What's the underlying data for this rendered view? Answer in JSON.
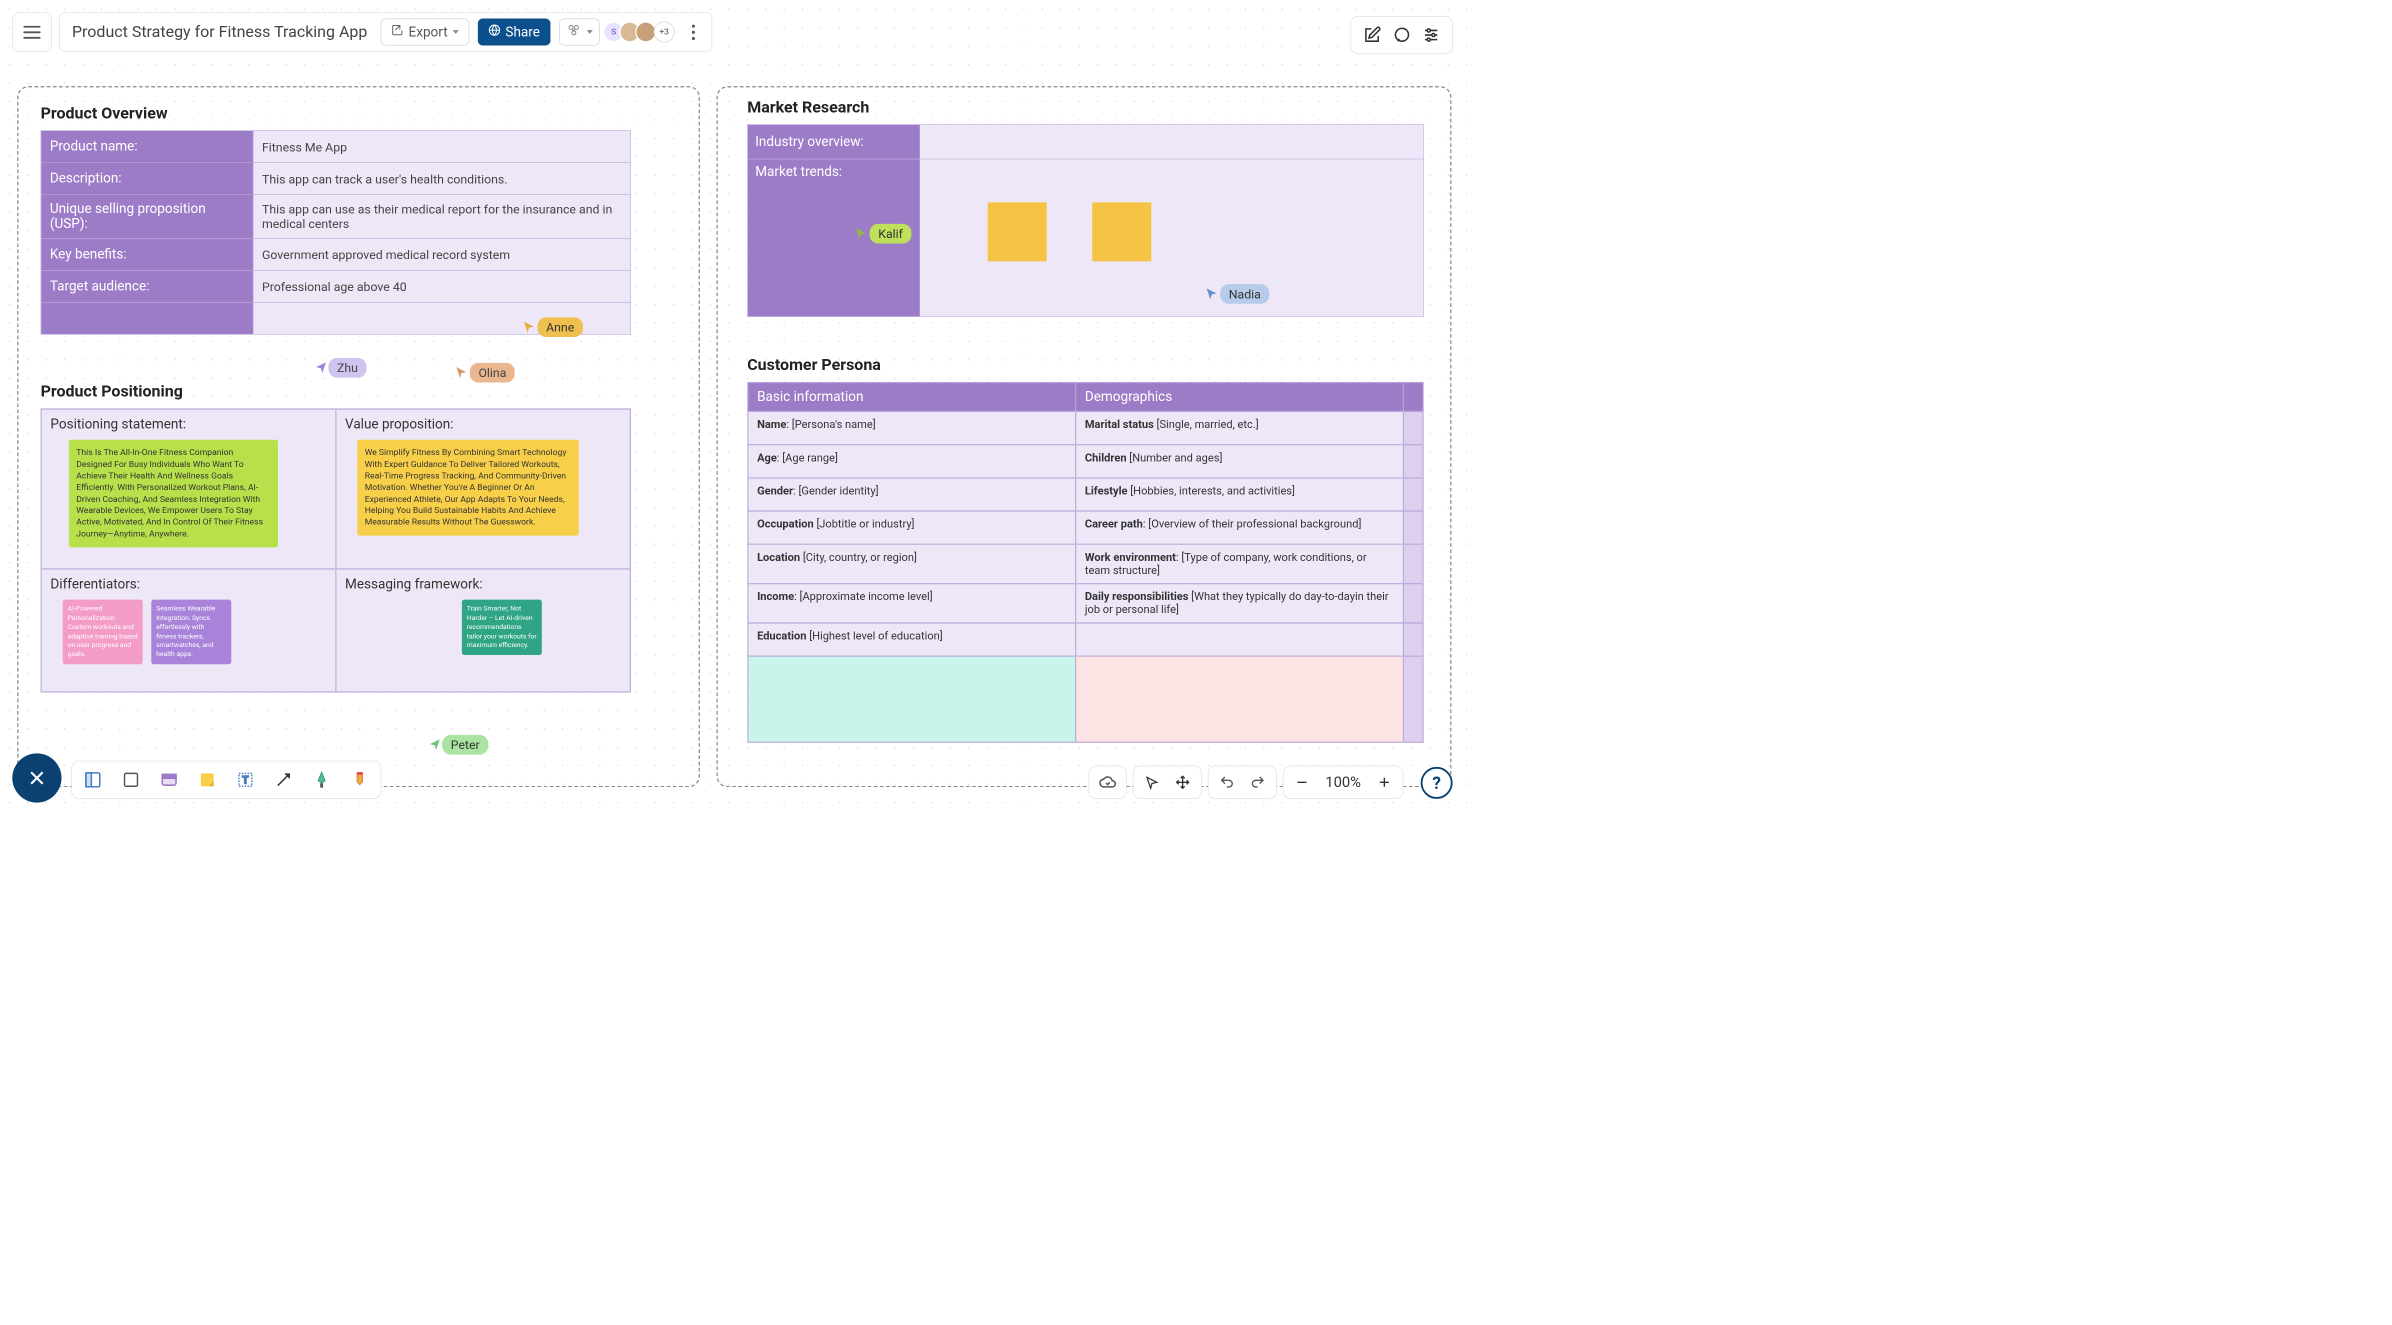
{
  "doc_title": "Product Strategy for Fitness Tracking App",
  "toolbar": {
    "export": "Export",
    "share": "Share",
    "more_avatars": "+3"
  },
  "zoom": {
    "value": "100%"
  },
  "product_overview": {
    "title": "Product Overview",
    "rows": [
      {
        "label": "Product name:",
        "value": "Fitness Me App"
      },
      {
        "label": "Description:",
        "value": "This app can track a user's health conditions."
      },
      {
        "label": "Unique selling proposition (USP):",
        "value": "This app can use as their medical report for the insurance and in medical centers"
      },
      {
        "label": "Key benefits:",
        "value": "Government approved medical record system"
      },
      {
        "label": "Target audience:",
        "value": "Professional age above 40"
      },
      {
        "label": "",
        "value": ""
      }
    ]
  },
  "product_positioning": {
    "title": "Product Positioning",
    "positioning_label": "Positioning statement:",
    "positioning_text": "This Is The All-In-One Fitness Companion Designed For Busy Individuals Who Want To Achieve Their Health And Wellness Goals Efficiently. With Personalized Workout Plans, AI-Driven Coaching, And Seamless Integration With Wearable Devices, We Empower Users To Stay Active, Motivated, And In Control Of Their Fitness Journey—Anytime, Anywhere.",
    "value_label": "Value proposition:",
    "value_text": "We Simplify Fitness By Combining Smart Technology With Expert Guidance To Deliver Tailored Workouts, Real-Time Progress Tracking, And Community-Driven Motivation. Whether You're A Beginner Or An Experienced Athlete, Our App Adapts To Your Needs, Helping You Build Sustainable Habits And Achieve Measurable Results Without The Guesswork.",
    "diff_label": "Differentiators:",
    "diff_1": "AI-Powered Personalization: Custom workouts and adaptive training based on user progress and goals.",
    "diff_2": "Seamless Wearable Integration: Syncs effortlessly with fitness trackers, smartwatches, and health apps.",
    "msg_label": "Messaging framework:",
    "msg_text": "Train Smarter, Not Harder – Let AI-driven recommendations tailor your workouts for maximum efficiency."
  },
  "market_research": {
    "title": "Market Research",
    "industry_label": "Industry overview:",
    "trends_label": "Market trends:"
  },
  "customer_persona": {
    "title": "Customer Persona",
    "hdr_basic": "Basic information",
    "hdr_demo": "Demographics",
    "left": [
      {
        "k": "Name",
        "v": ": [Persona's name]"
      },
      {
        "k": "Age",
        "v": ": [Age range]"
      },
      {
        "k": "Gender",
        "v": ": [Gender identity]"
      },
      {
        "k": "Occupation",
        "v": " [Jobtitle or industry]"
      },
      {
        "k": "Location",
        "v": " [City, country, or region]"
      },
      {
        "k": "Income",
        "v": ": [Approximate income level]"
      },
      {
        "k": "Education",
        "v": " [Highest level of education]"
      }
    ],
    "right": [
      {
        "k": "Marital status",
        "v": " [Single, married, etc.]"
      },
      {
        "k": "Children",
        "v": " [Number and ages]"
      },
      {
        "k": "Lifestyle",
        "v": " [Hobbies, interests, and activities]"
      },
      {
        "k": "Career path",
        "v": ": [Overview of their professional background]"
      },
      {
        "k": "Work environment",
        "v": ": [Type of company, work conditions, or team structure]"
      },
      {
        "k": "Daily responsibilities",
        "v": " [What they typically do day-to-dayin their job or personal life]"
      },
      {
        "k": "",
        "v": ""
      }
    ]
  },
  "cursors": {
    "anne": "Anne",
    "zhu": "Zhu",
    "olina": "Olina",
    "peter": "Peter",
    "kalif": "Kalif",
    "nadia": "Nadia"
  }
}
